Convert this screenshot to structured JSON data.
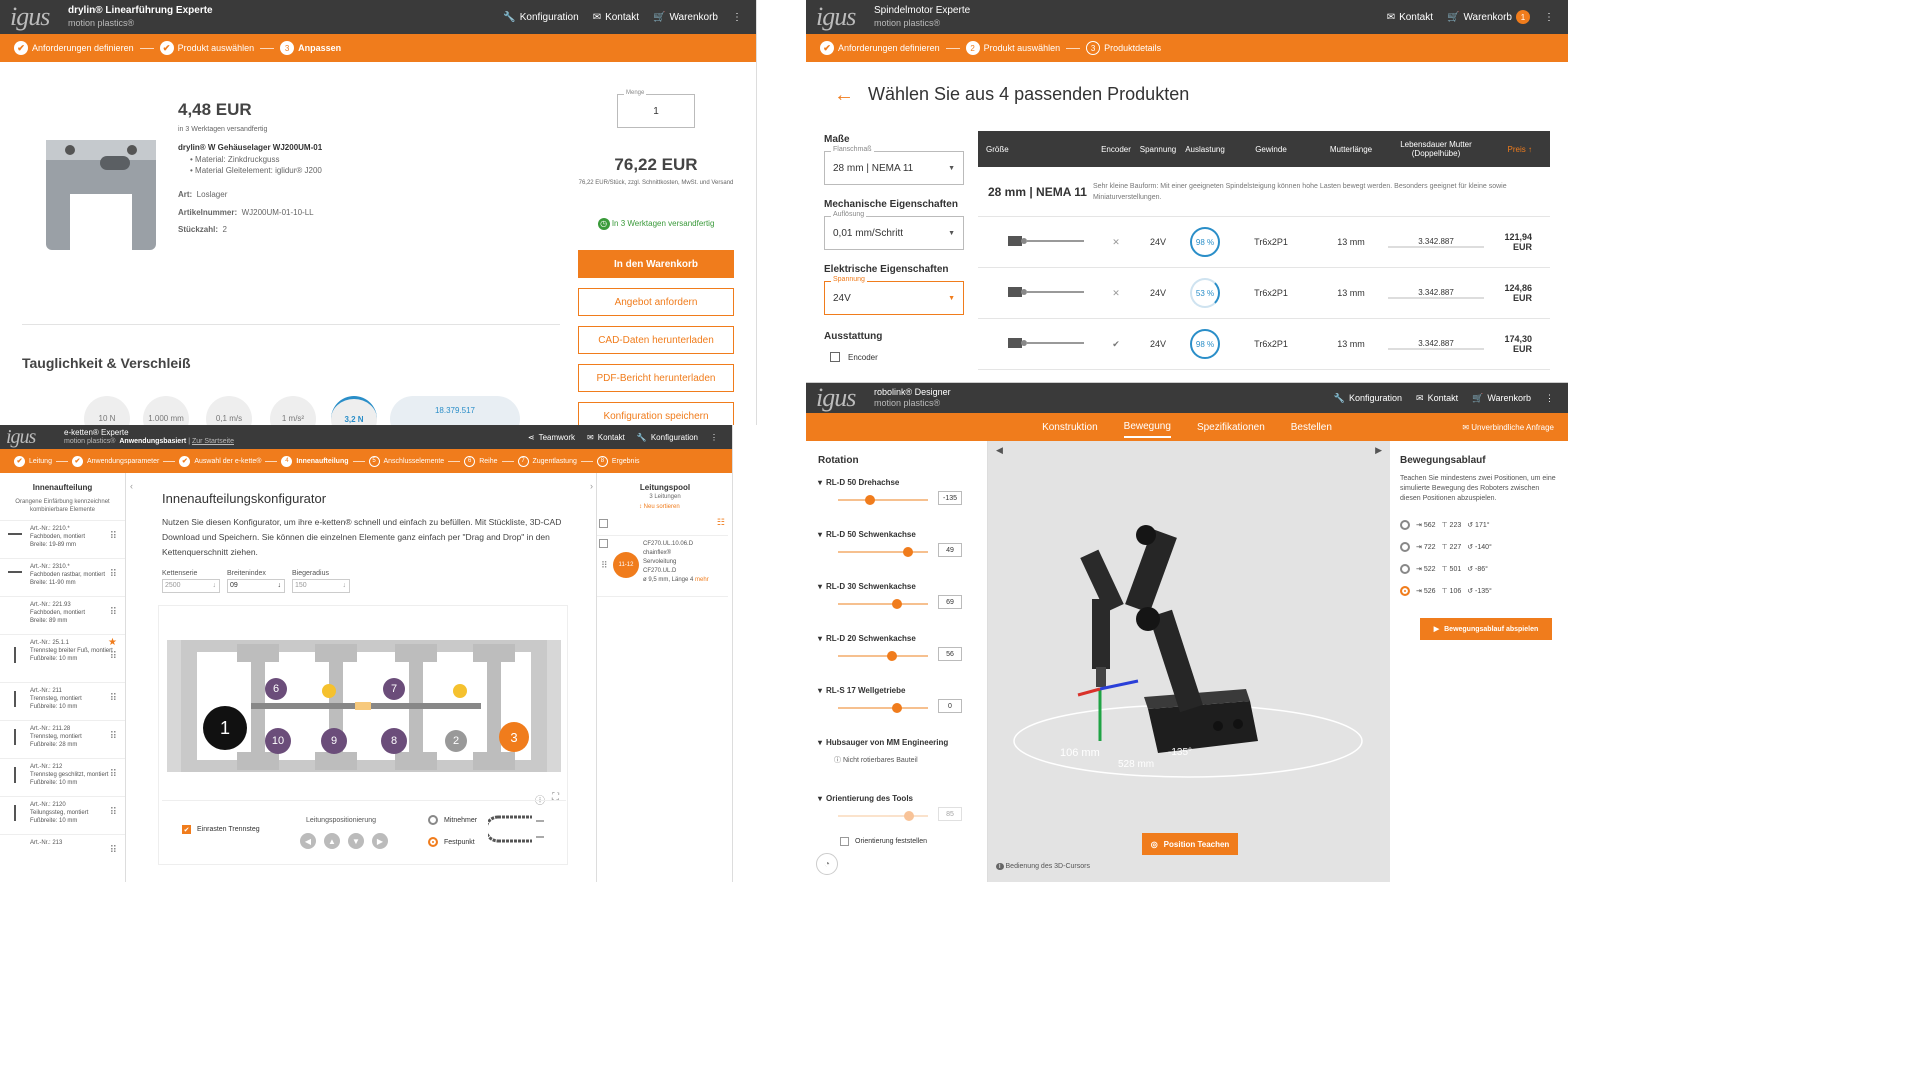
{
  "p1": {
    "title": "drylin® Linearführung Experte",
    "subtitle": "motion plastics®",
    "nav": [
      "Konfiguration",
      "Kontakt",
      "Warenkorb"
    ],
    "steps": [
      "Anforderungen definieren",
      "Produkt auswählen",
      "Anpassen"
    ],
    "step_active_num": "3",
    "price": "4,48 EUR",
    "ship_note": "in 3 Werktagen versandfertig",
    "product_name": "drylin® W Gehäuselager WJ200UM-01",
    "bullets": [
      "Material: Zinkdruckguss",
      "Material Gleitelement: iglidur® J200"
    ],
    "art_label": "Art:",
    "art_value": "Loslager",
    "artnr_label": "Artikelnummer:",
    "artnr_value": "WJ200UM-01-10-LL",
    "qty_label": "Stückzahl:",
    "qty_value": "2",
    "menge_label": "Menge",
    "menge_value": "1",
    "total": "76,22 EUR",
    "total_note": "76,22 EUR/Stück, zzgl. Schnittkosten, MwSt. und Versand",
    "ship_badge": "In 3 Werktagen versandfertig",
    "btn_cart": "In den Warenkorb",
    "btn_offer": "Angebot anfordern",
    "btn_cad": "CAD-Daten herunterladen",
    "btn_pdf": "PDF-Bericht herunterladen",
    "btn_save": "Konfiguration speichern",
    "section": "Tauglichkeit & Verschleiß",
    "gauges": [
      "10 N",
      "1.000 mm",
      "0,1 m/s",
      "1 m/s²",
      "3,2 N",
      "18.379.517"
    ]
  },
  "p2": {
    "title": "Spindelmotor Experte",
    "subtitle": "motion plastics®",
    "nav": [
      "Kontakt",
      "Warenkorb"
    ],
    "cart_count": "1",
    "steps": [
      "Anforderungen definieren",
      "Produkt auswählen",
      "Produktdetails"
    ],
    "heading": "Wählen Sie aus 4 passenden Produkten",
    "masse": "Maße",
    "flansch_label": "Flanschmaß",
    "flansch_value": "28 mm | NEMA 11",
    "mech": "Mechanische Eigenschaften",
    "aufl_label": "Auflösung",
    "aufl_value": "0,01 mm/Schritt",
    "elek": "Elektrische Eigenschaften",
    "spann_label": "Spannung",
    "spann_value": "24V",
    "ausst": "Ausstattung",
    "encoder": "Encoder",
    "cols": [
      "Größe",
      "Encoder",
      "Spannung",
      "Auslastung",
      "Gewinde",
      "Mutterlänge",
      "Lebensdauer Mutter (Doppelhübe)",
      "Preis ↑"
    ],
    "group_title": "28 mm | NEMA 11",
    "group_desc": "Sehr kleine Bauform: Mit einer geeigneten Spindelsteigung können hohe Lasten bewegt werden. Besonders geeignet für kleine sowie Miniaturverstellungen.",
    "rows": [
      {
        "encoder": "✕",
        "spannung": "24V",
        "auslastung": "98 %",
        "load": 0.98,
        "gewinde": "Tr6x2P1",
        "mutter": "13 mm",
        "leben": "3.342.887",
        "preis": "121,94 EUR"
      },
      {
        "encoder": "✕",
        "spannung": "24V",
        "auslastung": "53 %",
        "load": 0.53,
        "gewinde": "Tr6x2P1",
        "mutter": "13 mm",
        "leben": "3.342.887",
        "preis": "124,86 EUR"
      },
      {
        "encoder": "✔",
        "spannung": "24V",
        "auslastung": "98 %",
        "load": 0.98,
        "gewinde": "Tr6x2P1",
        "mutter": "13 mm",
        "leben": "3.342.887",
        "preis": "174,30 EUR"
      }
    ]
  },
  "p3": {
    "title": "e-ketten® Experte",
    "subtitle": "motion plastics®",
    "mode": "Anwendungsbasiert",
    "home_link": "Zur Startseite",
    "nav": [
      "Teamwork",
      "Kontakt",
      "Konfiguration"
    ],
    "steps": [
      "Leitung",
      "Anwendungsparameter",
      "Auswahl der e-kette®",
      "Innenaufteilung",
      "Anschlusselemente",
      "Reihe",
      "Zugentlastung",
      "Ergebnis"
    ],
    "step_nums": [
      "4",
      "5",
      "6",
      "7",
      "8"
    ],
    "left_head": "Innenaufteilung",
    "left_sub": "Orangene Einfärbung kennzeichnet kombinierbare Elemente",
    "items": [
      [
        "Art.-Nr.: 2210.*",
        "Fachboden, montiert",
        "Breite: 19-89 mm"
      ],
      [
        "Art.-Nr.: 2310.*",
        "Fachboden rastbar, montiert",
        "Breite: 11-90 mm"
      ],
      [
        "Art.-Nr.: 221.93",
        "Fachboden, montiert",
        "Breite: 89 mm"
      ],
      [
        "Art.-Nr.: 25.1.1",
        "Trennsteg breiter Fuß, montiert",
        "Fußbreite: 10 mm"
      ],
      [
        "Art.-Nr.: 211",
        "Trennsteg, montiert",
        "Fußbreite: 10 mm"
      ],
      [
        "Art.-Nr.: 211.28",
        "Trennsteg, montiert",
        "Fußbreite: 28 mm"
      ],
      [
        "Art.-Nr.: 212",
        "Trennsteg geschlitzt, montiert",
        "Fußbreite: 10 mm"
      ],
      [
        "Art.-Nr.: 2120",
        "Teilungssteg, montiert",
        "Fußbreite: 10 mm"
      ],
      [
        "Art.-Nr.: 213",
        ""
      ]
    ],
    "heading": "Innenaufteilungskonfigurator",
    "desc": "Nutzen Sie diesen Konfigurator, um ihre e-ketten® schnell und einfach zu befüllen. Mit Stückliste, 3D-CAD Download und Speichern. Sie können die einzelnen Elemente ganz einfach per \"Drag and Drop\" in den Kettenquerschnitt ziehen.",
    "f1_label": "Kettenserie",
    "f1_value": "2500",
    "f2_label": "Breitenindex",
    "f2_value": "09",
    "f3_label": "Biegeradius",
    "f3_value": "150",
    "circles": [
      "1",
      "6",
      "7",
      "10",
      "9",
      "8",
      "2",
      "3"
    ],
    "einrasten": "Einrasten Trennsteg",
    "posit": "Leitungspositionierung",
    "mit": "Mitnehmer",
    "fest": "Festpunkt",
    "pool": "Leitungspool",
    "pool_count": "3 Leitungen",
    "pool_new": "Neu sortieren",
    "pool_item": [
      "CF270.UL.10.06.D",
      "chainflex®",
      "Servoleitung",
      "CF270.UL.D",
      "ø 9,5 mm, Länge 4"
    ],
    "pool_badge": "11-12",
    "pool_more": "mehr"
  },
  "p4": {
    "title": "robolink® Designer",
    "subtitle": "motion plastics®",
    "nav": [
      "Konfiguration",
      "Kontakt",
      "Warenkorb"
    ],
    "tabs": [
      "Konstruktion",
      "Bewegung",
      "Spezifikationen",
      "Bestellen"
    ],
    "inquiry": "Unverbindliche Anfrage",
    "rotation": "Rotation",
    "axes": [
      {
        "name": "RL-D 50 Drehachse",
        "value": "-135",
        "pos": 0.35
      },
      {
        "name": "RL-D 50 Schwenkachse",
        "value": "49",
        "pos": 0.78
      },
      {
        "name": "RL-D 30 Schwenkachse",
        "value": "69",
        "pos": 0.65
      },
      {
        "name": "RL-D 20 Schwenkachse",
        "value": "56",
        "pos": 0.6
      },
      {
        "name": "RL-S 17 Wellgetriebe",
        "value": "0",
        "pos": 0.65
      }
    ],
    "vacuum": "Hubsauger von MM Engineering",
    "vacuum_note": "Nicht rotierbares Bauteil",
    "orient": "Orientierung des Tools",
    "orient_value": "85",
    "orient_fix": "Orientierung feststellen",
    "teach": "Position Teachen",
    "cursor_help": "Bedienung des 3D-Cursors",
    "scene_labels": [
      "106 mm",
      "528 mm",
      "-135°"
    ],
    "seq_title": "Bewegungsablauf",
    "seq_desc": "Teachen Sie mindestens zwei Positionen, um eine simulierte Bewegung des Roboters zwischen diesen Positionen abzuspielen.",
    "positions": [
      [
        "562",
        "223",
        "171°"
      ],
      [
        "722",
        "227",
        "-140°"
      ],
      [
        "522",
        "501",
        "-86°"
      ],
      [
        "526",
        "106",
        "-135°"
      ]
    ],
    "play": "Bewegungsablauf abspielen"
  }
}
